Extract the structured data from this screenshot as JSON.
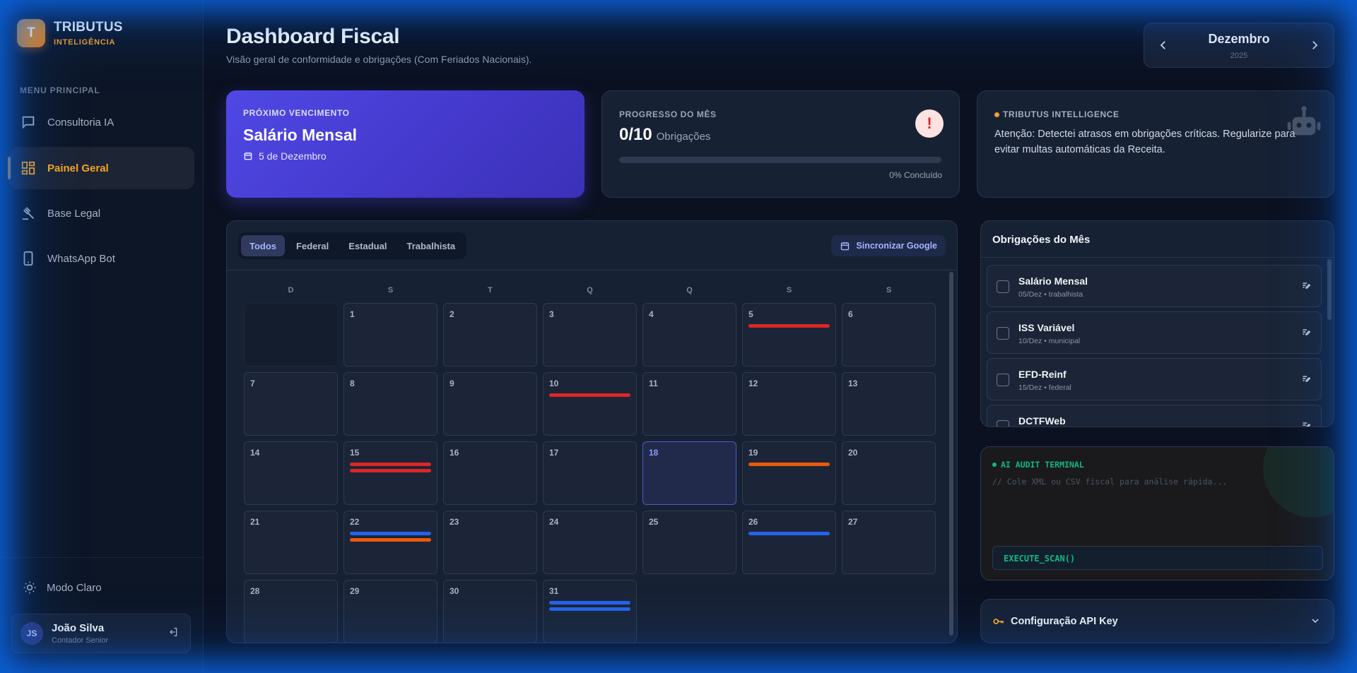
{
  "brand": {
    "logo_letter": "T",
    "name": "TRIBUTUS",
    "subtitle": "INTELIGÊNCIA"
  },
  "sidebar": {
    "menu_title": "MENU PRINCIPAL",
    "items": [
      {
        "label": "Consultoria IA",
        "icon": "chat-icon",
        "active": false
      },
      {
        "label": "Painel Geral",
        "icon": "dashboard-icon",
        "active": true
      },
      {
        "label": "Base Legal",
        "icon": "gavel-icon",
        "active": false
      },
      {
        "label": "WhatsApp Bot",
        "icon": "phone-icon",
        "active": false
      }
    ],
    "mode_toggle": "Modo Claro",
    "user": {
      "initials": "JS",
      "name": "João Silva",
      "role": "Contador Senior"
    }
  },
  "header": {
    "title": "Dashboard Fiscal",
    "subtitle": "Visão geral de conformidade e obrigações (Com Feriados Nacionais).",
    "month": "Dezembro",
    "year": "2025"
  },
  "next_due": {
    "label": "PRÓXIMO VENCIMENTO",
    "title": "Salário Mensal",
    "date": "5 de Dezembro"
  },
  "progress": {
    "label": "PROGRESSO DO MÊS",
    "count": "0/10",
    "unit": "Obrigações",
    "percent": 0,
    "percent_text": "0% Concluído",
    "alert_symbol": "!"
  },
  "ai_card": {
    "label": "TRIBUTUS INTELLIGENCE",
    "message": "Atenção: Detectei atrasos em obrigações críticas. Regularize para evitar multas automáticas da Receita."
  },
  "calendar": {
    "filters": [
      "Todos",
      "Federal",
      "Estadual",
      "Trabalhista"
    ],
    "active_filter": "Todos",
    "sync_label": "Sincronizar Google",
    "weekdays": [
      "D",
      "S",
      "T",
      "Q",
      "Q",
      "S",
      "S"
    ],
    "leading_empty_days": 1,
    "days_in_month": 31,
    "today": 18,
    "events": {
      "5": [
        "red"
      ],
      "10": [
        "red"
      ],
      "15": [
        "red",
        "red"
      ],
      "19": [
        "orange"
      ],
      "22": [
        "blue",
        "orange"
      ],
      "26": [
        "blue"
      ],
      "31": [
        "blue",
        "blue"
      ]
    }
  },
  "colors": {
    "red": "#dc2626",
    "orange": "#ea580c",
    "blue": "#2563eb",
    "accent": "#f5a623",
    "indigo": "#4f46e5",
    "terminal_green": "#10b981"
  },
  "obligations": {
    "title": "Obrigações do Mês",
    "items": [
      {
        "name": "Salário Mensal",
        "meta": "05/Dez • trabalhista"
      },
      {
        "name": "ISS Variável",
        "meta": "10/Dez • municipal"
      },
      {
        "name": "EFD-Reinf",
        "meta": "15/Dez • federal"
      },
      {
        "name": "DCTFWeb",
        "meta": ""
      }
    ]
  },
  "terminal": {
    "title": "AI AUDIT TERMINAL",
    "placeholder": "// Cole XML ou CSV fiscal para análise rápida...",
    "button": "EXECUTE_SCAN()"
  },
  "api_config": {
    "label": "Configuração API Key"
  }
}
